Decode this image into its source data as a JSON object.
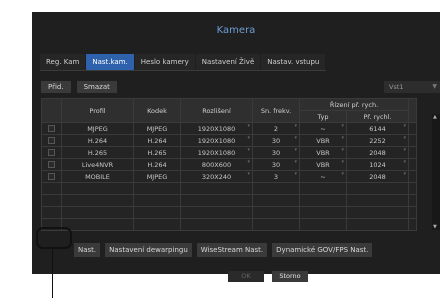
{
  "title": "Kamera",
  "tabs": [
    "Reg. Kam",
    "Nast.kam.",
    "Heslo kamery",
    "Nastavení Živě",
    "Nastav. vstupu"
  ],
  "active_tab": "Nast.kam.",
  "toolbar": {
    "add": "Přid.",
    "delete": "Smazat",
    "stream_select": "Vst1"
  },
  "table": {
    "headers": {
      "profile": "Profil",
      "codec": "Kodek",
      "resolution": "Rozlišení",
      "fps": "Sn. frekv.",
      "rate_control": "Řízení př. rych.",
      "type": "Typ",
      "bitrate": "Př. rychl."
    },
    "rows": [
      {
        "profile": "MJPEG",
        "codec": "MJPEG",
        "resolution": "1920X1080",
        "fps": "2",
        "type": "~",
        "bitrate": "6144"
      },
      {
        "profile": "H.264",
        "codec": "H.264",
        "resolution": "1920X1080",
        "fps": "30",
        "type": "VBR",
        "bitrate": "2252"
      },
      {
        "profile": "H.265",
        "codec": "H.265",
        "resolution": "1920X1080",
        "fps": "30",
        "type": "VBR",
        "bitrate": "2048"
      },
      {
        "profile": "Live4NVR",
        "codec": "H.264",
        "resolution": "800X600",
        "fps": "30",
        "type": "VBR",
        "bitrate": "1024"
      },
      {
        "profile": "MOBILE",
        "codec": "MJPEG",
        "resolution": "320X240",
        "fps": "3",
        "type": "~",
        "bitrate": "2048"
      }
    ]
  },
  "bottom_buttons": [
    "Nast.",
    "Nastavení dewarpingu",
    "WiseStream Nast.",
    "Dynamické GOV/FPS Nast."
  ],
  "footer": {
    "ok": "OK",
    "cancel": "Storno"
  },
  "colors": {
    "accent": "#2e62ad",
    "title": "#6f9dd8",
    "bg": "#1f1f1f"
  }
}
